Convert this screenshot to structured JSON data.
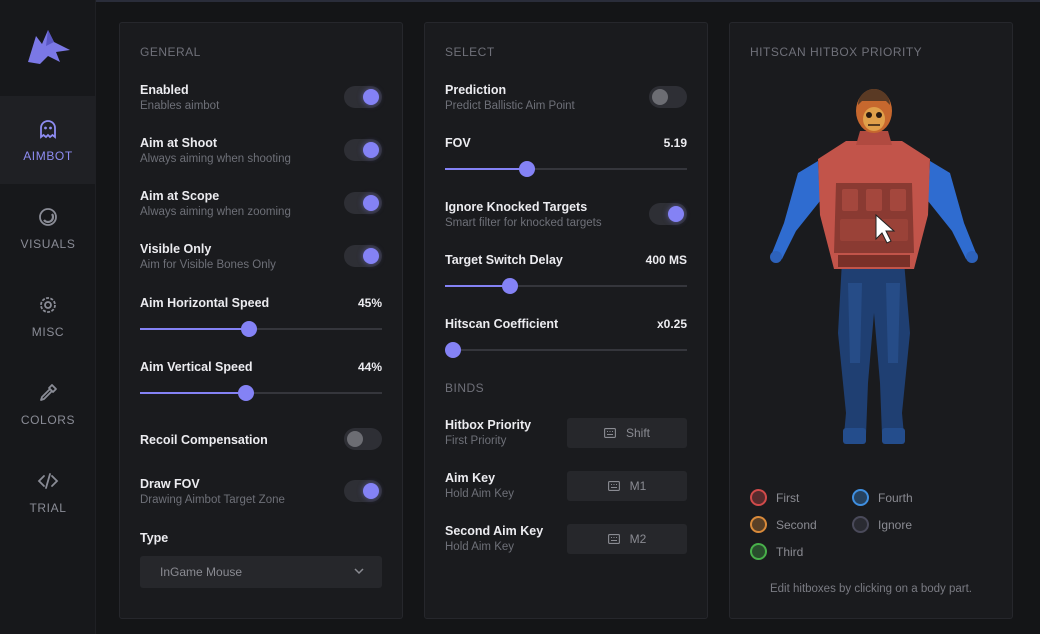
{
  "sidebar": {
    "items": [
      {
        "label": "AIMBOT",
        "icon": "ghost-icon",
        "active": true
      },
      {
        "label": "VISUALS",
        "icon": "eye-icon",
        "active": false
      },
      {
        "label": "MISC",
        "icon": "gear-icon",
        "active": false
      },
      {
        "label": "COLORS",
        "icon": "eyedropper-icon",
        "active": false
      },
      {
        "label": "TRIAL",
        "icon": "code-icon",
        "active": false
      }
    ]
  },
  "general": {
    "title": "GENERAL",
    "enabled": {
      "title": "Enabled",
      "sub": "Enables aimbot",
      "on": true
    },
    "aim_at_shoot": {
      "title": "Aim at Shoot",
      "sub": "Always aiming when shooting",
      "on": true
    },
    "aim_at_scope": {
      "title": "Aim at Scope",
      "sub": "Always aiming when zooming",
      "on": true
    },
    "visible_only": {
      "title": "Visible Only",
      "sub": "Aim for Visible Bones Only",
      "on": true
    },
    "aim_h_speed": {
      "title": "Aim Horizontal Speed",
      "value": "45%",
      "level": 0.45
    },
    "aim_v_speed": {
      "title": "Aim Vertical Speed",
      "value": "44%",
      "level": 0.44
    },
    "recoil": {
      "title": "Recoil Compensation",
      "on": false
    },
    "draw_fov": {
      "title": "Draw FOV",
      "sub": "Drawing Aimbot Target Zone",
      "on": true
    },
    "type": {
      "title": "Type",
      "value": "InGame Mouse"
    }
  },
  "select": {
    "title": "SELECT",
    "prediction": {
      "title": "Prediction",
      "sub": "Predict Ballistic Aim Point",
      "on": false
    },
    "fov": {
      "title": "FOV",
      "value": "5.19",
      "level": 0.34
    },
    "ignore_knocked": {
      "title": "Ignore Knocked Targets",
      "sub": "Smart filter for knocked targets",
      "on": true
    },
    "switch_delay": {
      "title": "Target Switch Delay",
      "value": "400 MS",
      "level": 0.27
    },
    "hitscan_coef": {
      "title": "Hitscan Coefficient",
      "value": "x0.25",
      "level": 0.0
    },
    "binds_title": "BINDS",
    "binds": [
      {
        "title": "Hitbox Priority",
        "sub": "First Priority",
        "key": "Shift"
      },
      {
        "title": "Aim Key",
        "sub": "Hold Aim Key",
        "key": "M1"
      },
      {
        "title": "Second Aim Key",
        "sub": "Hold Aim Key",
        "key": "M2"
      }
    ]
  },
  "hitscan": {
    "title": "HITSCAN HITBOX PRIORITY",
    "legend": [
      {
        "label": "First",
        "color": "#d04a4a"
      },
      {
        "label": "Second",
        "color": "#d98a3a"
      },
      {
        "label": "Third",
        "color": "#48b04a"
      },
      {
        "label": "Fourth",
        "color": "#3f8fe0"
      },
      {
        "label": "Ignore",
        "color": "#4a4a5a"
      }
    ],
    "hint": "Edit hitboxes by clicking on a body part."
  },
  "colors": {
    "accent": "#8482f5",
    "bg": "#141517",
    "panel": "#1a1b1e"
  }
}
